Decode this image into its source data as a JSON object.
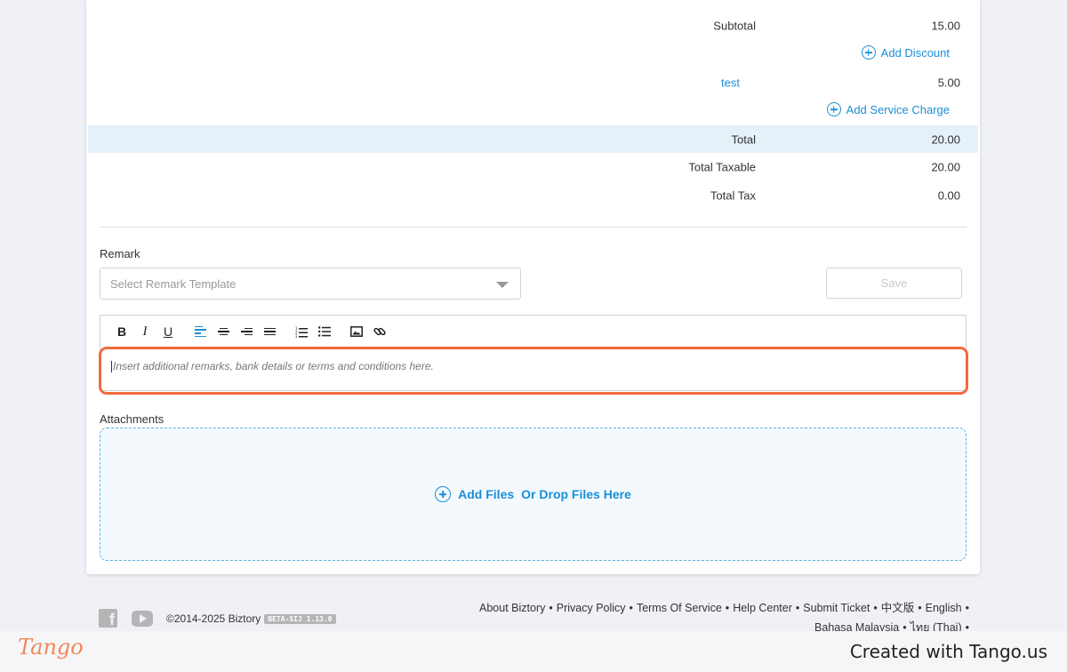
{
  "summary": {
    "subtotal_label": "Subtotal",
    "subtotal_value": "15.00",
    "add_discount": "Add Discount",
    "charge_name": "test",
    "charge_value": "5.00",
    "add_service_charge": "Add Service Charge",
    "total_label": "Total",
    "total_value": "20.00",
    "taxable_label": "Total Taxable",
    "taxable_value": "20.00",
    "tax_label": "Total Tax",
    "tax_value": "0.00"
  },
  "remark": {
    "label": "Remark",
    "template_placeholder": "Select Remark Template",
    "save_label": "Save",
    "toolbar": {
      "bold": "B",
      "italic": "I",
      "underline": "U"
    },
    "editor_placeholder": "Insert additional remarks, bank details or terms and conditions here."
  },
  "attachments": {
    "label": "Attachments",
    "add_files": "Add Files",
    "drop_files": "Or Drop Files Here"
  },
  "footer": {
    "copyright": "©2014-2025 Biztory",
    "version": "BETA-SIJ 1.13.0",
    "links": [
      "About Biztory",
      "Privacy Policy",
      "Terms Of Service",
      "Help Center",
      "Submit Ticket",
      "中文版",
      "English",
      "Bahasa Malaysia",
      "ไทย (Thai)"
    ],
    "separator": "•"
  },
  "overlay": {
    "logo": "Tango",
    "credit": "Created with Tango.us"
  },
  "colors": {
    "accent": "#1a8fd6",
    "highlight": "#f06b3e",
    "total_row_bg": "#e4f1f9"
  }
}
